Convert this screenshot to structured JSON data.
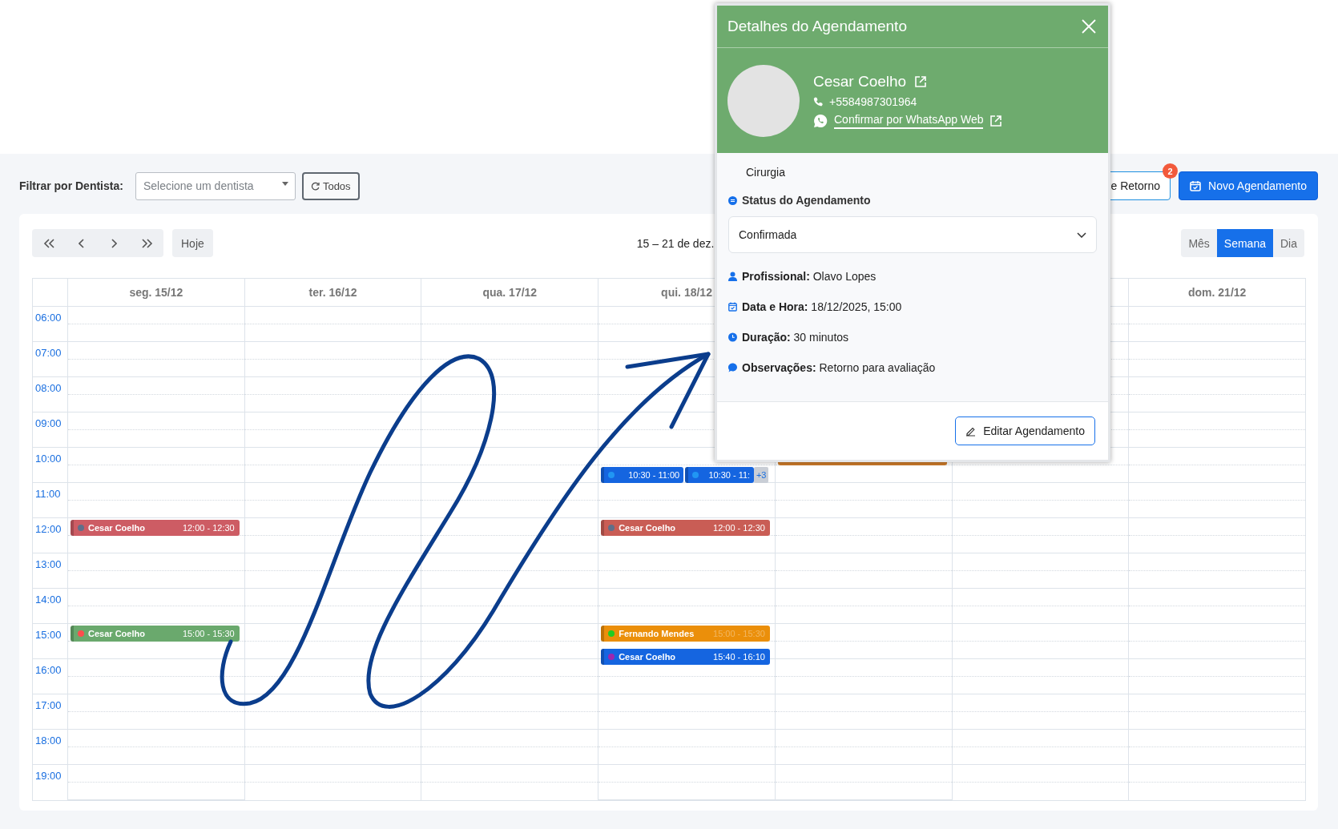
{
  "filter": {
    "label": "Filtrar por Dentista:",
    "placeholder": "Selecione um dentista",
    "reset_button": "Todos"
  },
  "actions": {
    "return_button": "e Retorno",
    "return_badge": "2",
    "new_button": "Novo Agendamento"
  },
  "calendar": {
    "today_button": "Hoje",
    "range_title": "15 – 21 de dez.",
    "views": [
      {
        "label": "Mês",
        "selected": false
      },
      {
        "label": "Semana",
        "selected": true
      },
      {
        "label": "Dia",
        "selected": false
      }
    ],
    "hours": [
      "06:00",
      "07:00",
      "08:00",
      "09:00",
      "10:00",
      "11:00",
      "12:00",
      "13:00",
      "14:00",
      "15:00",
      "16:00",
      "17:00",
      "18:00",
      "19:00"
    ],
    "days": [
      {
        "label": "seg. 15/12",
        "events": [
          {
            "kind": "full",
            "patient": "Cesar Coelho",
            "time": "12:00 - 12:30",
            "color": "#cd5c64",
            "dot": {
              "color": "#5f6f8a"
            },
            "time_faded": false
          },
          {
            "kind": "full",
            "patient": "Cesar Coelho",
            "time": "15:00 - 15:30",
            "color": "#6aa96d",
            "dot": {
              "color": "#ff4d4d"
            },
            "time_faded": false
          }
        ]
      },
      {
        "label": "ter. 16/12"
      },
      {
        "label": "qua. 17/12"
      },
      {
        "label": "qui. 18/12",
        "events": [
          {
            "kind": "stack",
            "items": [
              {
                "time": "10:30 - 11:00",
                "color": "#1565e0",
                "dot": {
                  "color": "#2196f3"
                }
              },
              {
                "time": "10:30 - 11:",
                "color": "#1565e0",
                "dot": {
                  "color": "#2196f3"
                }
              }
            ],
            "more": "+3"
          },
          {
            "kind": "full",
            "patient": "Cesar Coelho",
            "time": "12:00 - 12:30",
            "color": "#c95d55",
            "dot": {
              "color": "#5f6f8a"
            },
            "time_faded": false
          },
          {
            "kind": "full",
            "patient": "Fernando Mendes",
            "time": "15:00 - 15:30",
            "color": "#eb8f0a",
            "dot": {
              "color": "#22cc22"
            },
            "time_faded": true
          },
          {
            "kind": "full",
            "patient": "Cesar Coelho",
            "time": "15:40 - 16:10",
            "color": "#1565e0",
            "dot": {
              "color": "#9c27b0"
            },
            "time_faded": false
          }
        ]
      },
      {
        "covered": true,
        "events": [
          {
            "kind": "covered",
            "color": "#c97a2a"
          }
        ]
      },
      {
        "covered": true
      },
      {
        "label": "dom. 21/12"
      }
    ]
  },
  "modal": {
    "title": "Detalhes do Agendamento",
    "patient": {
      "name": "Cesar Coelho",
      "phone": "+5584987301964",
      "whatsapp_link": "Confirmar por WhatsApp Web"
    },
    "procedure": "Cirurgia",
    "status": {
      "label": "Status do Agendamento",
      "value": "Confirmada"
    },
    "details": [
      {
        "kind": "person",
        "text": "**Profissional:** Olavo Lopes"
      },
      {
        "kind": "calendar",
        "text": "**Data e Hora:** 18/12/2025, 15:00"
      },
      {
        "kind": "clock",
        "text": "**Duração:** 30 minutos"
      },
      {
        "kind": "chat",
        "text": "**Observações:** Retorno para avaliação"
      }
    ],
    "edit_button": "Editar Agendamento"
  }
}
